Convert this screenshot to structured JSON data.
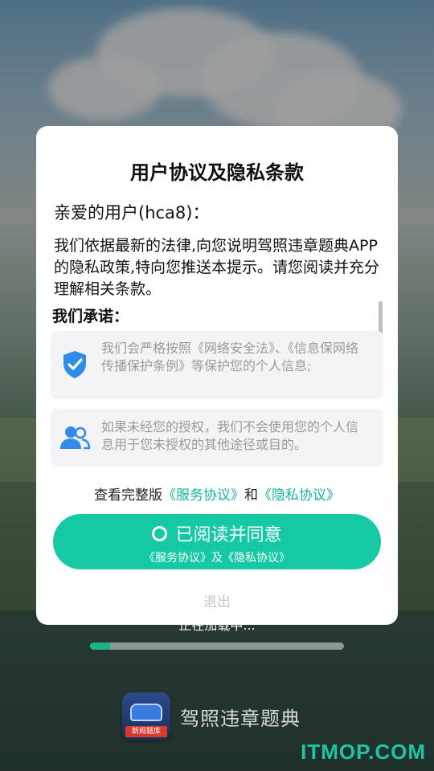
{
  "background": {
    "loading_text": "正在加载中...",
    "progress": 0.08,
    "app_name": "驾照违章题典",
    "app_icon_tag": "新规题库",
    "watermark": "ITMOP.COM"
  },
  "dialog": {
    "title": "用户协议及隐私条款",
    "greeting": "亲爱的用户(hca8)：",
    "intro": "我们依据最新的法律,向您说明驾照违章题典APP的隐私政策,特向您推送本提示。请您阅读并充分理解相关条款。",
    "promise_title": "我们承诺：",
    "promises": [
      {
        "icon": "shield-check-icon",
        "text": "我们会严格按照《网络安全法》、《信息保网络传播保护条例》等保护您的个人信息;"
      },
      {
        "icon": "users-icon",
        "text": "如果未经您的授权，我们不会使用您的个人信息用于您未授权的其他途径或目的。"
      }
    ],
    "links_prefix": "查看完整版",
    "service_link": "《服务协议》",
    "links_and": "和",
    "privacy_link": "《隐私协议》",
    "agree_label": "已阅读并同意",
    "agree_sub": "《服务协议》及《隐私协议》",
    "exit_label": "退出"
  },
  "colors": {
    "accent": "#14c9a3",
    "link": "#14b89a",
    "icon_blue": "#2f8ce8"
  }
}
